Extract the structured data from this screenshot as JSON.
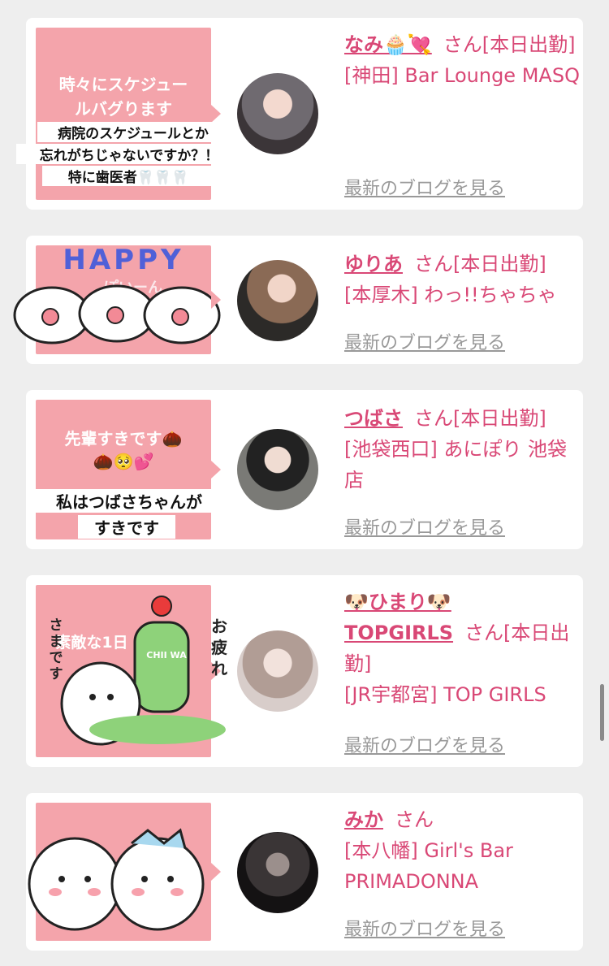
{
  "cards": [
    {
      "name": "なみ🧁💘",
      "san": "さん[本日出勤]",
      "store": "[神田] Bar Lounge MASQ",
      "blog": "最新のブログを見る",
      "sticker": {
        "line1": "時々にスケジュー",
        "line2": "ルバグります",
        "overlay1": "病院のスケジュールとか",
        "overlay2": "忘れがちじゃないですか？！",
        "overlay3": "特に歯医者🦷🦷🦷"
      }
    },
    {
      "name": "ゆりあ",
      "san": "さん[本日出勤]",
      "store": "[本厚木] わっ!!ちゃちゃ",
      "blog": "最新のブログを見る",
      "sticker": {
        "word": "HAPPY",
        "sub": "ぽいーん"
      }
    },
    {
      "name": "つばさ",
      "san": "さん[本日出勤]",
      "store": "[池袋西口] あにぽり 池袋店",
      "blog": "最新のブログを見る",
      "sticker": {
        "line1": "先輩すきです🌰",
        "line2": "🌰🥺💕",
        "overlay1": "私はつばさちゃんが",
        "overlay2": "すきです"
      }
    },
    {
      "name": "🐶ひまり🐶",
      "name2": "TOPGIRLS",
      "san": "さん[本日出勤]",
      "store": "[JR宇都宮] TOP GIRLS",
      "blog": "最新のブログを見る",
      "sticker": {
        "text": "素敵な1日",
        "side": "さまです",
        "right": "お疲れ",
        "cup": "CHII WA"
      }
    },
    {
      "name": "みか",
      "san": "さん",
      "store": "[本八幡] Girl's Bar PRIMADONNA",
      "blog": "最新のブログを見る"
    }
  ],
  "colors": {
    "accent": "#d94876",
    "bubble": "#f4a4ab",
    "background": "#eeeeee"
  }
}
